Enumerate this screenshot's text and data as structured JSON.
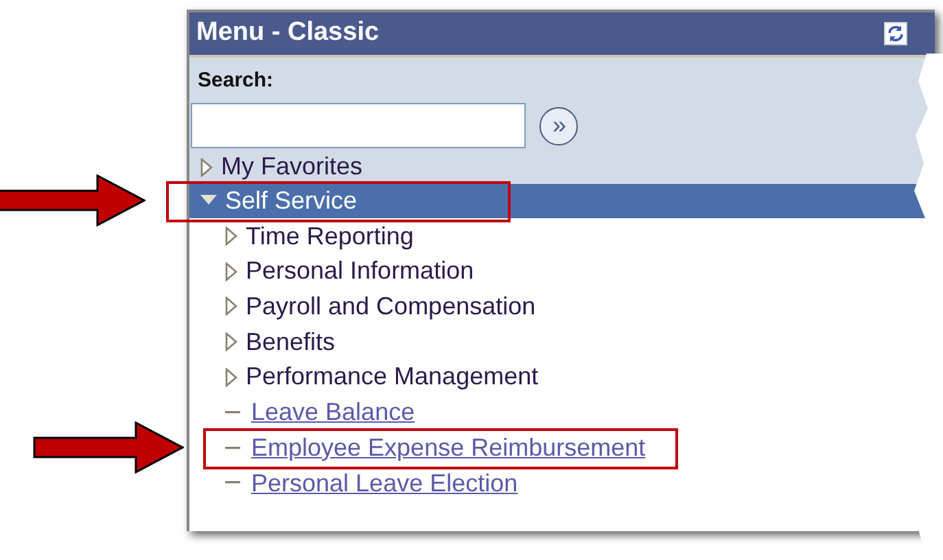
{
  "menu": {
    "title": "Menu - Classic",
    "search": {
      "label": "Search:",
      "go": "»"
    },
    "items": [
      {
        "label": "My Favorites",
        "kind": "folder",
        "expanded": false,
        "selected": false,
        "highlighted": false
      },
      {
        "label": "Self Service",
        "kind": "folder",
        "expanded": true,
        "selected": true,
        "highlighted": true,
        "children": [
          {
            "label": "Time Reporting",
            "kind": "folder",
            "expanded": false,
            "selected": false,
            "highlighted": false
          },
          {
            "label": "Personal Information",
            "kind": "folder",
            "expanded": false,
            "selected": false,
            "highlighted": false
          },
          {
            "label": "Payroll and Compensation",
            "kind": "folder",
            "expanded": false,
            "selected": false,
            "highlighted": false
          },
          {
            "label": "Benefits",
            "kind": "folder",
            "expanded": false,
            "selected": false,
            "highlighted": false
          },
          {
            "label": "Performance Management",
            "kind": "folder",
            "expanded": false,
            "selected": false,
            "highlighted": false
          },
          {
            "label": "Leave Balance",
            "kind": "link",
            "selected": false,
            "highlighted": false
          },
          {
            "label": "Employee Expense Reimbursement",
            "kind": "link",
            "selected": false,
            "highlighted": true
          },
          {
            "label": "Personal Leave Election",
            "kind": "link",
            "selected": false,
            "highlighted": false
          }
        ]
      }
    ]
  }
}
